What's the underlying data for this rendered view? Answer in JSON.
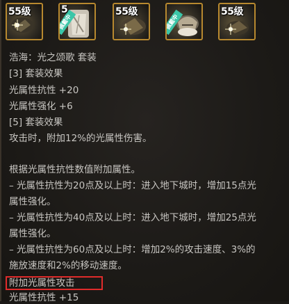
{
  "slots": [
    {
      "level": "55级",
      "equipped_tag": ""
    },
    {
      "level": "5",
      "equipped_tag": "佩戴中"
    },
    {
      "level": "55级",
      "equipped_tag": ""
    },
    {
      "level": "",
      "equipped_tag": "佩戴中"
    },
    {
      "level": "55级",
      "equipped_tag": ""
    }
  ],
  "description": {
    "set_name": "浩海：光之颂歌 套装",
    "set3_title": "[3] 套装效果",
    "set3_line1": "光属性抗性 +20",
    "set3_line2": "光属性强化 +6",
    "set5_title": "[5] 套装效果",
    "set5_line1": "攻击时，附加12%的光属性伤害。",
    "extra_intro": "根据光属性抗性数值附加属性。",
    "tier20_a": "– 光属性抗性为20点及以上时：进入地下城时，增加15点光",
    "tier20_b": "属性强化。",
    "tier40_a": "– 光属性抗性为40点及以上时：进入地下城时，增加25点光",
    "tier40_b": "属性强化。",
    "tier60_a": "– 光属性抗性为60点及以上时：增加2%的攻击速度、3%的",
    "tier60_b": "施放速度和2%的移动速度。",
    "attack_label": "附加光属性攻击",
    "bottom_line": "光属性抗性 +15"
  },
  "colors": {
    "slot_border": "#b8892f",
    "text": "#c8c6c2",
    "highlight_box": "#e02b2b",
    "equip_tag": "#3bc6a8"
  }
}
